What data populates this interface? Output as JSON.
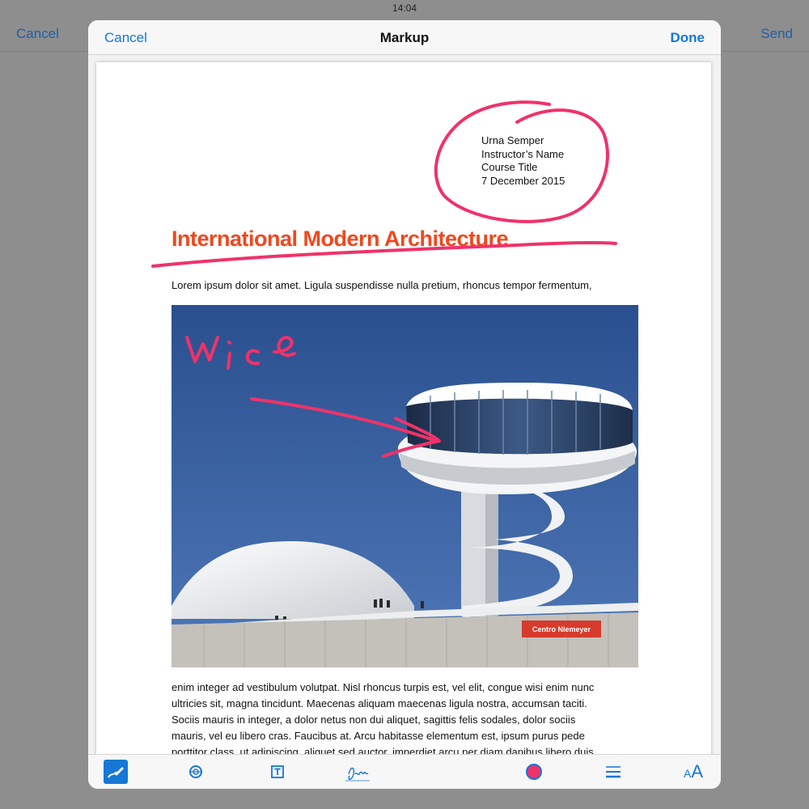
{
  "status_bar": {
    "time": "14:04"
  },
  "background_nav": {
    "cancel_label": "Cancel",
    "send_label": "Send"
  },
  "markup_nav": {
    "cancel_label": "Cancel",
    "title": "Markup",
    "done_label": "Done"
  },
  "document": {
    "meta_lines": [
      "Urna Semper",
      "Instructor’s Name",
      "Course Title",
      "7 December 2015"
    ],
    "title": "International Modern Architecture",
    "intro": "Lorem ipsum dolor sit amet. Ligula suspendisse nulla pretium, rhoncus tempor fermentum,",
    "photo_sign": "Centro Niemeyer",
    "body_lines": [
      "enim integer ad vestibulum volutpat. Nisl rhoncus turpis est, vel elit, congue wisi enim nunc",
      "ultricies sit, magna tincidunt. Maecenas aliquam maecenas ligula nostra, accumsan taciti.",
      "Sociis mauris in integer, a dolor netus non dui aliquet, sagittis felis sodales, dolor sociis",
      "mauris, vel eu libero cras. Faucibus at. Arcu habitasse elementum est, ipsum purus pede",
      "porttitor class, ut adipiscing, aliquet sed auctor, imperdiet arcu per diam dapibus libero duis"
    ]
  },
  "toolbar": {
    "tools": [
      "sketch-tool-icon",
      "magnifier-tool-icon",
      "text-tool-icon",
      "signature-tool-icon",
      "color-picker-icon",
      "line-width-icon",
      "text-size-icon"
    ],
    "text_size_small": "A",
    "text_size_large": "A"
  },
  "colors": {
    "accent_blue": "#1677d6",
    "markup_ink": "#f0326a",
    "title_orange": "#f0481e",
    "sign_red": "#d63b2c"
  }
}
